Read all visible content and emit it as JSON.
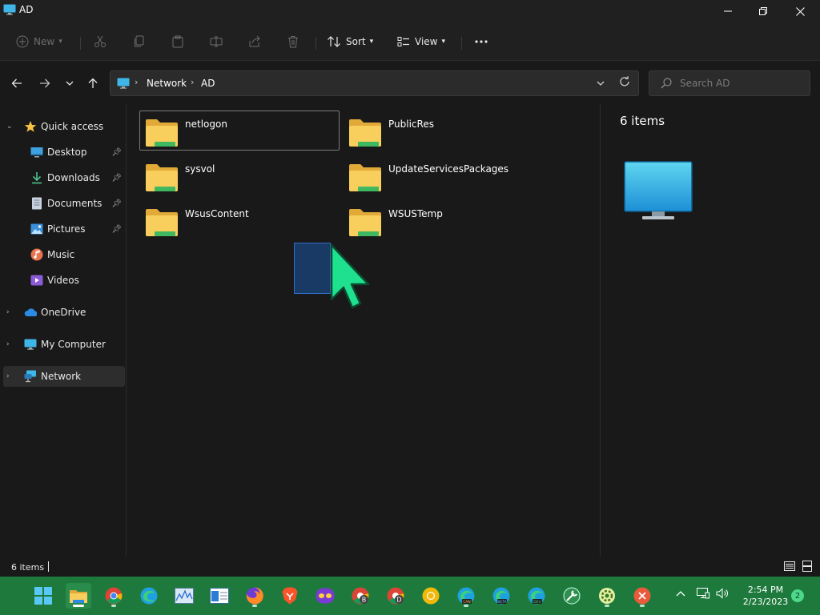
{
  "window": {
    "title": "AD"
  },
  "commands": {
    "new": "New",
    "sort": "Sort",
    "view": "View"
  },
  "address": {
    "crumbs": [
      "Network",
      "AD"
    ]
  },
  "search": {
    "placeholder": "Search AD"
  },
  "sidebar": {
    "items": [
      {
        "label": "Quick access",
        "icon": "star-icon"
      },
      {
        "label": "Desktop",
        "icon": "desktop-icon",
        "pinned": true
      },
      {
        "label": "Downloads",
        "icon": "download-icon",
        "pinned": true
      },
      {
        "label": "Documents",
        "icon": "document-icon",
        "pinned": true
      },
      {
        "label": "Pictures",
        "icon": "pictures-icon",
        "pinned": true
      },
      {
        "label": "Music",
        "icon": "music-icon"
      },
      {
        "label": "Videos",
        "icon": "videos-icon"
      },
      {
        "label": "OneDrive",
        "icon": "cloud-icon"
      },
      {
        "label": "My Computer",
        "icon": "computer-icon"
      },
      {
        "label": "Network",
        "icon": "network-icon",
        "selected": true
      }
    ]
  },
  "folders": [
    {
      "name": "netlogon"
    },
    {
      "name": "PublicRes"
    },
    {
      "name": "sysvol"
    },
    {
      "name": "UpdateServicesPackages"
    },
    {
      "name": "WsusContent"
    },
    {
      "name": "WSUSTemp"
    }
  ],
  "details": {
    "count": "6 items"
  },
  "status": {
    "items": "6 items"
  },
  "taskbar": {
    "time": "2:54 PM",
    "date": "2/23/2023",
    "notifications": "2",
    "accent": "#1e7a3c"
  }
}
